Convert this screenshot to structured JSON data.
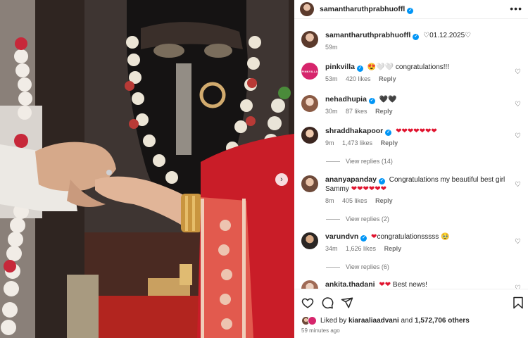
{
  "post": {
    "author": "samantharuthprabhuoffl",
    "caption_text": "01.12.2025",
    "caption_heart": "♡",
    "time": "59m",
    "more_icon": "more-horizontal-icon"
  },
  "comments": [
    {
      "user": "pinkvilla",
      "avatar_text": "PINKVILLA",
      "text_prefix": "😍🤍🤍",
      "text": " congratulations!!!",
      "time": "53m",
      "likes": "420 likes",
      "reply": "Reply"
    },
    {
      "user": "nehadhupia",
      "text": "🖤🖤",
      "time": "30m",
      "likes": "87 likes",
      "reply": "Reply"
    },
    {
      "user": "shraddhakapoor",
      "text": "❤❤❤❤❤❤❤",
      "time": "9m",
      "likes": "1,473 likes",
      "reply": "Reply",
      "view_replies": "View replies (14)"
    },
    {
      "user": "ananyapanday",
      "text": "Congratulations my beautiful best girl Sammy",
      "text_hearts": "❤❤❤❤❤❤",
      "time": "8m",
      "likes": "405 likes",
      "reply": "Reply",
      "view_replies": "View replies (2)"
    },
    {
      "user": "varundvn",
      "text_prefix": "❤",
      "text": "congratulationsssss 🥹",
      "time": "34m",
      "likes": "1,626 likes",
      "reply": "Reply",
      "view_replies": "View replies (6)"
    },
    {
      "user": "ankita.thadani",
      "text_prefix": "❤❤",
      "text": " Best news!"
    }
  ],
  "footer": {
    "liked_by_prefix": "Liked by",
    "liked_by_user": "kiaraaliaadvani",
    "liked_by_and": "and",
    "liked_by_others": "1,572,706 others",
    "time_ago": "59 minutes ago"
  },
  "colors": {
    "accent": "#0095f6",
    "heart_red": "#e0132e",
    "muted": "#737373"
  }
}
